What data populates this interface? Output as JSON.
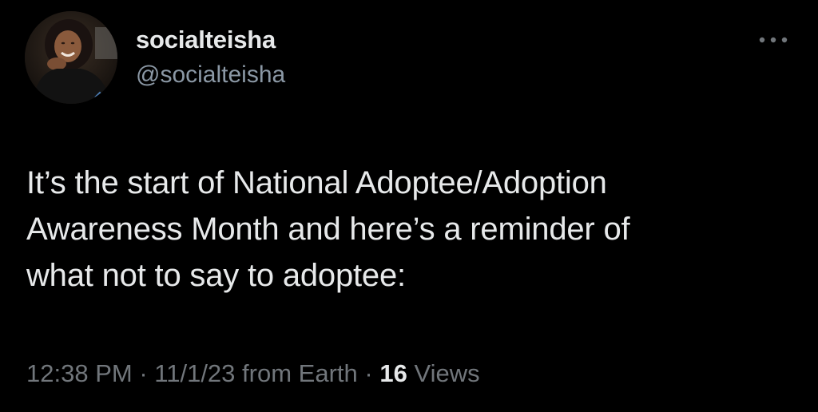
{
  "author": {
    "display_name": "socialteisha",
    "handle": "@socialteisha",
    "avatar_icon": "profile-photo"
  },
  "more_icon": "more-horizontal-icon",
  "tweet": {
    "text_lines": [
      "It’s the start of National Adoptee/Adoption",
      "Awareness Month and here’s a reminder of",
      "what not to say to adoptee:"
    ]
  },
  "meta": {
    "time": "12:38 PM",
    "separator": "·",
    "date": "11/1/23",
    "source": "from Earth",
    "views_count": "16",
    "views_label": "Views"
  },
  "colors": {
    "background": "#000000",
    "primary_text": "#e7e9ea",
    "secondary_text": "#71767b",
    "handle_text": "#8b98a5"
  }
}
